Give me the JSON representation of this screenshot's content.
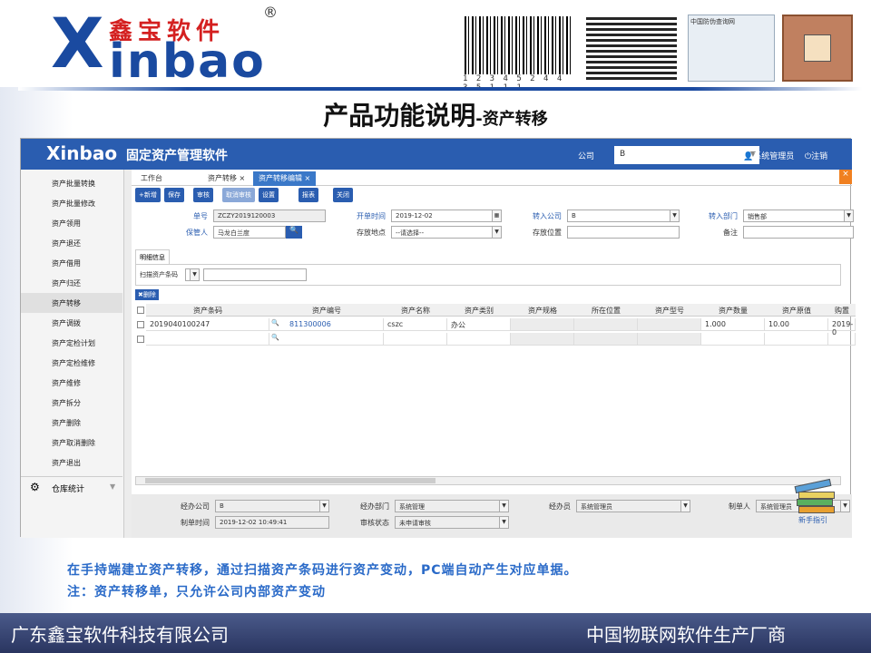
{
  "brand": {
    "logo_x": "X",
    "logo_cn": "鑫宝软件",
    "logo_reg": "®",
    "logo_inbao": "inbao"
  },
  "barcode_number": "1 2 3 4 5 2 4 4 3 5 1 1 1",
  "anti_fake_label": "中国防伪查询网",
  "title": {
    "main": "产品功能说明",
    "sub": "-资产转移"
  },
  "app": {
    "logo": "Xinbao",
    "name": "固定资产管理软件",
    "company_label": "公司",
    "company_value": "B",
    "user": "系统管理员",
    "logout": "注销"
  },
  "sidebar": {
    "items": [
      "资产批量转换",
      "资产批量修改",
      "资产领用",
      "资产退还",
      "资产借用",
      "资产归还",
      "资产转移",
      "资产调拨",
      "资产定检计划",
      "资产定检维修",
      "资产维修",
      "资产拆分",
      "资产删除",
      "资产取消删除",
      "资产退出"
    ],
    "active_index": 6,
    "footer": "仓库统计"
  },
  "tabs": [
    "工作台",
    "资产转移",
    "资产转移编辑"
  ],
  "toolbar": [
    "+新增",
    "保存",
    "审核",
    "取消审核",
    "设置",
    "报表",
    "关闭"
  ],
  "form": {
    "doc_no_label": "单号",
    "doc_no": "ZCZY2019120003",
    "date_label": "开单时间",
    "date": "2019-12-02",
    "to_company_label": "转入公司",
    "to_company": "B",
    "to_dept_label": "转入部门",
    "to_dept": "销售部",
    "keeper_label": "保管人",
    "keeper": "马龙白兰度",
    "location_label": "存放地点",
    "location": "--请选择--",
    "position_label": "存放位置",
    "position": "",
    "remark_label": "备注",
    "remark": ""
  },
  "detail": {
    "tab": "明细信息",
    "scan_label": "扫描资产条码",
    "delete": "删除"
  },
  "grid": {
    "headers": [
      "资产条码",
      "资产编号",
      "资产名称",
      "资产类别",
      "资产规格",
      "所在位置",
      "资产型号",
      "资产数量",
      "资产原值",
      "购置"
    ],
    "rows": [
      [
        "2019040100247",
        "811300006",
        "cszc",
        "办公",
        "",
        "",
        "",
        "1.000",
        "10.00",
        "2019-0"
      ]
    ]
  },
  "footer_form": {
    "handler_company_label": "经办公司",
    "handler_company": "B",
    "handler_dept_label": "经办部门",
    "handler_dept": "系统管理",
    "handler_label": "经办员",
    "handler": "系统管理员",
    "creator_label": "制单人",
    "creator": "系统管理员",
    "created_at_label": "制单时间",
    "created_at": "2019-12-02 10:49:41",
    "audit_label": "审核状态",
    "audit": "未申请审核"
  },
  "guide": "新手指引",
  "notes": [
    "在手持端建立资产转移，通过扫描资产条码进行资产变动，PC端自动产生对应单据。",
    "注：资产转移单，只允许公司内部资产变动"
  ],
  "bottom": {
    "corp": "广东鑫宝软件科技有限公司",
    "slogan": "中国物联网软件生产厂商"
  },
  "colors": {
    "brand_blue": "#1a4aa0",
    "app_blue": "#2a5db0",
    "logo_red": "#d42020",
    "note_blue": "#2a6ac8"
  }
}
